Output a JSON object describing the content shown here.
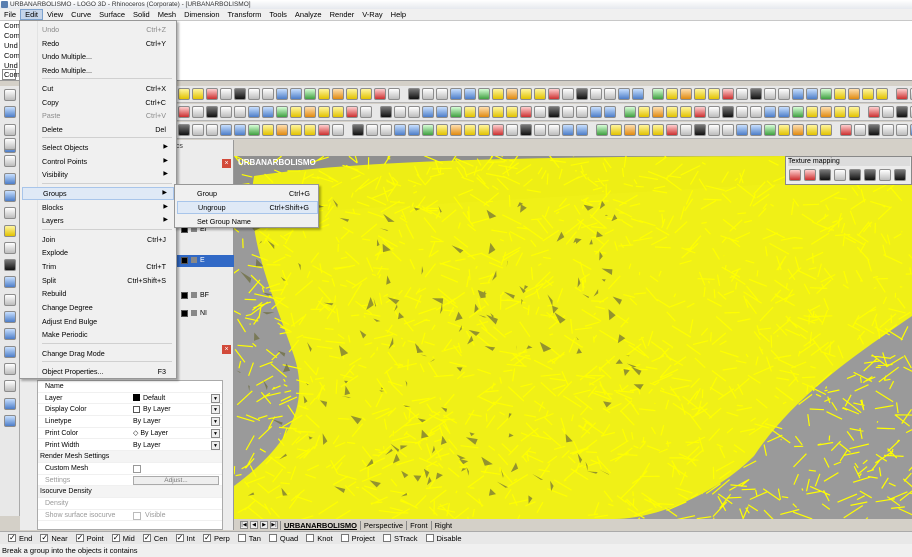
{
  "window": {
    "title": "URBANARBOLISMO - LOGO 3D - Rhinoceros (Corporate) - [URBANARBOLISMO]"
  },
  "menubar": {
    "items": [
      "File",
      "Edit",
      "View",
      "Curve",
      "Surface",
      "Solid",
      "Mesh",
      "Dimension",
      "Transform",
      "Tools",
      "Analyze",
      "Render",
      "V-Ray",
      "Help"
    ],
    "active": "Edit"
  },
  "command_history": {
    "lines": [
      "Com",
      "Com",
      "Und",
      "Com",
      "Und",
      "Com"
    ],
    "prompt": "Com"
  },
  "edit_menu": {
    "items": [
      {
        "label": "Undo",
        "shortcut": "Ctrl+Z",
        "disabled": true
      },
      {
        "label": "Redo",
        "shortcut": "Ctrl+Y"
      },
      {
        "label": "Undo Multiple..."
      },
      {
        "label": "Redo Multiple..."
      },
      {
        "label": "Cut",
        "shortcut": "Ctrl+X"
      },
      {
        "label": "Copy",
        "shortcut": "Ctrl+C"
      },
      {
        "label": "Paste",
        "shortcut": "Ctrl+V",
        "disabled": true
      },
      {
        "label": "Delete",
        "shortcut": "Del"
      },
      {
        "label": "Select Objects",
        "submenu": true
      },
      {
        "label": "Control Points",
        "submenu": true
      },
      {
        "label": "Visibility",
        "submenu": true
      },
      {
        "label": "Groups",
        "submenu": true,
        "highlighted": true
      },
      {
        "label": "Blocks",
        "submenu": true
      },
      {
        "label": "Layers",
        "submenu": true
      },
      {
        "label": "Join",
        "shortcut": "Ctrl+J"
      },
      {
        "label": "Explode"
      },
      {
        "label": "Trim",
        "shortcut": "Ctrl+T"
      },
      {
        "label": "Split",
        "shortcut": "Ctrl+Shift+S"
      },
      {
        "label": "Rebuild"
      },
      {
        "label": "Change Degree"
      },
      {
        "label": "Adjust End Bulge"
      },
      {
        "label": "Make Periodic"
      },
      {
        "label": "Change Drag Mode"
      },
      {
        "label": "Object Properties...",
        "shortcut": "F3"
      }
    ]
  },
  "groups_submenu": {
    "items": [
      {
        "label": "Group",
        "shortcut": "Ctrl+G"
      },
      {
        "label": "Ungroup",
        "shortcut": "Ctrl+Shift+G",
        "highlighted": true
      },
      {
        "label": "Set Group Name"
      }
    ]
  },
  "layers_panel": {
    "tab_label": "trics",
    "rows": [
      "Ef",
      "E",
      "BF",
      "NI"
    ]
  },
  "properties": {
    "rows": [
      {
        "label": "Name",
        "value": ""
      },
      {
        "label": "Layer",
        "value": "Default",
        "dropdown": true
      },
      {
        "label": "Display Color",
        "value": "By Layer",
        "dropdown": true
      },
      {
        "label": "Linetype",
        "value": "By Layer",
        "dropdown": true
      },
      {
        "label": "Print Color",
        "value": "By Layer",
        "dropdown": true
      },
      {
        "label": "Print Width",
        "value": "By Layer",
        "dropdown": true
      }
    ],
    "render_mesh_header": "Render Mesh Settings",
    "custom_mesh_label": "Custom Mesh",
    "settings_label": "Settings",
    "adjust_label": "Adjust...",
    "isocurve_header": "Isocurve Density",
    "density_label": "Density",
    "show_isocurve_label": "Show surface isocurve",
    "visible_label": "Visible"
  },
  "viewport": {
    "title": "URBANARBOLISMO",
    "tabs": [
      "URBANARBOLISMO",
      "Perspective",
      "Front",
      "Right"
    ],
    "active_tab": "URBANARBOLISMO",
    "wire_color": "#ffff00",
    "background_color": "#8f8f8f"
  },
  "texture_panel": {
    "title": "Texture mapping"
  },
  "osnaps": [
    {
      "label": "End",
      "checked": true
    },
    {
      "label": "Near",
      "checked": true
    },
    {
      "label": "Point",
      "checked": true
    },
    {
      "label": "Mid",
      "checked": true
    },
    {
      "label": "Cen",
      "checked": true
    },
    {
      "label": "Int",
      "checked": true
    },
    {
      "label": "Perp",
      "checked": true
    },
    {
      "label": "Tan",
      "checked": false
    },
    {
      "label": "Quad",
      "checked": false
    },
    {
      "label": "Knot",
      "checked": false
    },
    {
      "label": "Project",
      "checked": false
    },
    {
      "label": "STrack",
      "checked": false
    },
    {
      "label": "Disable",
      "checked": false
    }
  ],
  "status": {
    "text": "Break a group into the objects it contains"
  }
}
